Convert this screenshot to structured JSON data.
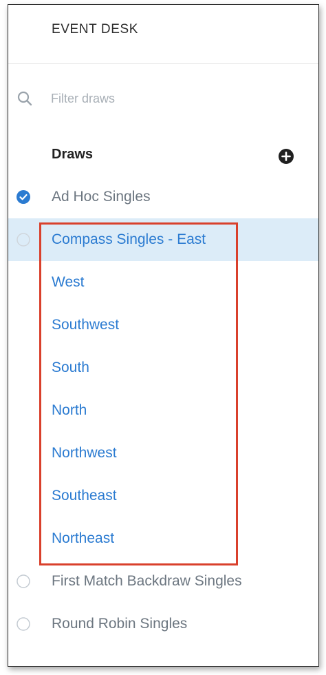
{
  "header": {
    "title": "EVENT DESK"
  },
  "search": {
    "placeholder": "Filter draws",
    "value": ""
  },
  "draws": {
    "title": "Draws",
    "add_icon": "plus-circle-icon",
    "items": [
      {
        "label": "Ad Hoc Singles",
        "state": "checked"
      },
      {
        "label": "Compass Singles - East",
        "state": "selected"
      },
      {
        "label": "West",
        "state": "child"
      },
      {
        "label": "Southwest",
        "state": "child"
      },
      {
        "label": "South",
        "state": "child"
      },
      {
        "label": "North",
        "state": "child"
      },
      {
        "label": "Northwest",
        "state": "child"
      },
      {
        "label": "Southeast",
        "state": "child"
      },
      {
        "label": "Northeast",
        "state": "child"
      },
      {
        "label": "First Match Backdraw Singles",
        "state": "unchecked"
      },
      {
        "label": "Round Robin Singles",
        "state": "unchecked"
      }
    ]
  },
  "colors": {
    "accent": "#2b7bd1",
    "selected_bg": "#dcecf8",
    "highlight_border": "#d9402c",
    "muted_text": "#6c7680"
  }
}
